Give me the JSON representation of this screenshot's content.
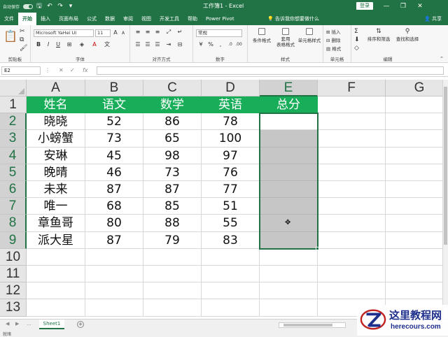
{
  "titlebar": {
    "autosave_label": "自动保存",
    "title": "工作簿1 - Excel",
    "login_label": "登录",
    "min_glyph": "—",
    "restore_glyph": "❐",
    "close_glyph": "✕"
  },
  "tabs": [
    {
      "label": "文件"
    },
    {
      "label": "开始"
    },
    {
      "label": "插入"
    },
    {
      "label": "页面布局"
    },
    {
      "label": "公式"
    },
    {
      "label": "数据"
    },
    {
      "label": "审阅"
    },
    {
      "label": "视图"
    },
    {
      "label": "开发工具"
    },
    {
      "label": "帮助"
    },
    {
      "label": "Power Pivot"
    }
  ],
  "active_tab": "开始",
  "tell_me": "告诉我你想要做什么",
  "share_label": "共享",
  "ribbon": {
    "groups": {
      "clipboard": "剪贴板",
      "font": "字体",
      "alignment": "对齐方式",
      "number": "数字",
      "styles": "样式",
      "cells": "单元格",
      "editing": "编辑"
    },
    "font_name": "Microsoft YaHei UI",
    "font_size": "11",
    "number_format": "常规",
    "bold": "B",
    "italic": "I",
    "underline": "U",
    "cond_format": "条件格式",
    "table_format": "套用\n表格格式",
    "cell_styles": "单元格样式",
    "insert": "插入",
    "delete": "删除",
    "format": "格式",
    "sort_filter": "排序和筛选",
    "find_select": "查找和选择"
  },
  "formula_bar": {
    "name_box": "E2",
    "fx": "fx",
    "value": ""
  },
  "columns": [
    "A",
    "B",
    "C",
    "D",
    "E",
    "F",
    "G"
  ],
  "rows": [
    "1",
    "2",
    "3",
    "4",
    "5",
    "6",
    "7",
    "8",
    "9",
    "10",
    "11",
    "12",
    "13"
  ],
  "table": {
    "headers": [
      "姓名",
      "语文",
      "数学",
      "英语",
      "总分"
    ],
    "data": [
      [
        "晓晓",
        "52",
        "86",
        "78",
        ""
      ],
      [
        "小螃蟹",
        "73",
        "65",
        "100",
        ""
      ],
      [
        "安琳",
        "45",
        "98",
        "97",
        ""
      ],
      [
        "晚晴",
        "46",
        "73",
        "76",
        ""
      ],
      [
        "未来",
        "87",
        "87",
        "77",
        ""
      ],
      [
        "唯一",
        "68",
        "85",
        "51",
        ""
      ],
      [
        "章鱼哥",
        "80",
        "88",
        "55",
        ""
      ],
      [
        "派大星",
        "87",
        "79",
        "83",
        ""
      ]
    ]
  },
  "colors": {
    "excel_green": "#217346",
    "header_fill": "#18ad59",
    "selection_fill": "#c6c6c6"
  },
  "sheet_tab": "Sheet1",
  "add_sheet": "+",
  "status_text": "就绪",
  "watermark": {
    "title": "这里教程网",
    "url": "herecours.com"
  }
}
